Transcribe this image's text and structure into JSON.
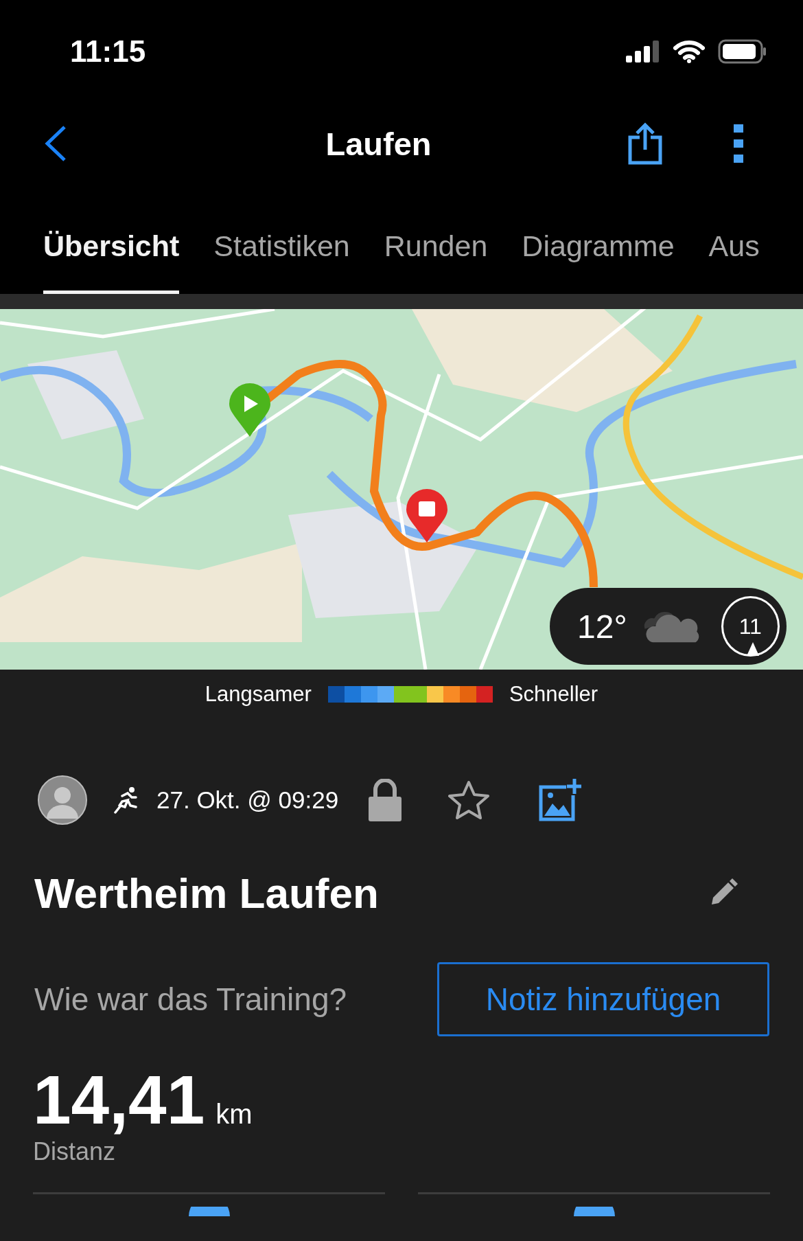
{
  "status_bar": {
    "time": "11:15"
  },
  "nav": {
    "title": "Laufen"
  },
  "tabs": [
    {
      "label": "Übersicht",
      "selected": true
    },
    {
      "label": "Statistiken",
      "selected": false
    },
    {
      "label": "Runden",
      "selected": false
    },
    {
      "label": "Diagramme",
      "selected": false
    },
    {
      "label": "Aus",
      "selected": false
    }
  ],
  "map": {
    "kind": "picture",
    "weather": {
      "temperature": "12°",
      "wind_speed": "11"
    }
  },
  "legend": {
    "slow_label": "Langsamer",
    "fast_label": "Schneller",
    "segments": [
      {
        "color": "#0d4fa3"
      },
      {
        "color": "#1e78d8"
      },
      {
        "color": "#3d96ef"
      },
      {
        "color": "#5caaf5"
      },
      {
        "color": "#82c41e"
      },
      {
        "color": "#82c41e"
      },
      {
        "color": "#f9c74a"
      },
      {
        "color": "#f88a25"
      },
      {
        "color": "#e5640f"
      },
      {
        "color": "#d42222"
      }
    ]
  },
  "activity": {
    "date": "27. Okt. @ 09:29",
    "favorite": false
  },
  "title": "Wertheim Laufen",
  "note": {
    "prompt": "Wie war das Training?",
    "button": "Notiz hinzufügen"
  },
  "distance": {
    "value": "14,41",
    "unit": "km",
    "label": "Distanz"
  }
}
